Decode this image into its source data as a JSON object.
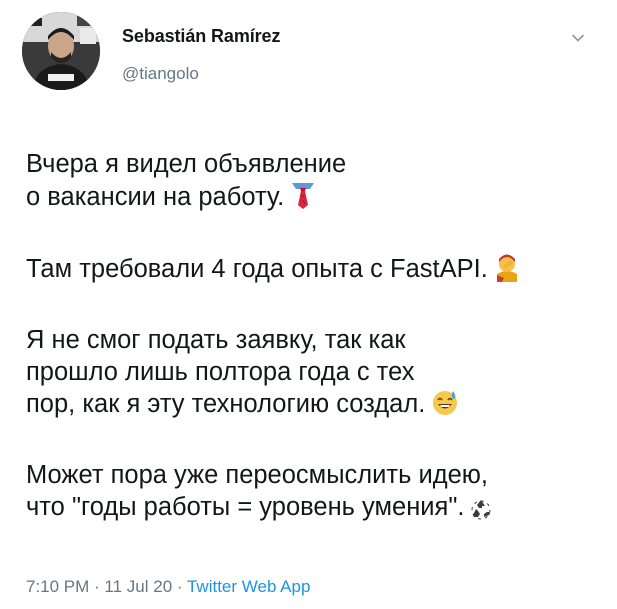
{
  "user": {
    "name": "Sebastián Ramírez",
    "handle": "@tiangolo"
  },
  "tweet": {
    "paragraphs": [
      [
        "Вчера я видел объявление",
        "о вакансии на работу."
      ],
      [
        "Там требовали 4 года опыта с FastAPI."
      ],
      [
        "Я не смог подать заявку, так как",
        "прошло лишь полтора года с тех",
        "пор, как я эту технологию создал."
      ],
      [
        "Может пора уже переосмыслить идею,",
        "что \"годы работы = уровень умения\"."
      ]
    ],
    "emojis": [
      "necktie-emoji",
      "facepalm-emoji",
      "sweat-smile-emoji",
      "recycle-emoji"
    ]
  },
  "meta": {
    "time": "7:10 PM",
    "separator1": " · ",
    "date": "11 Jul 20",
    "separator2": " · ",
    "source": "Twitter Web App"
  },
  "colors": {
    "text": "#14171a",
    "secondary": "#657786",
    "link": "#1b95e0"
  }
}
